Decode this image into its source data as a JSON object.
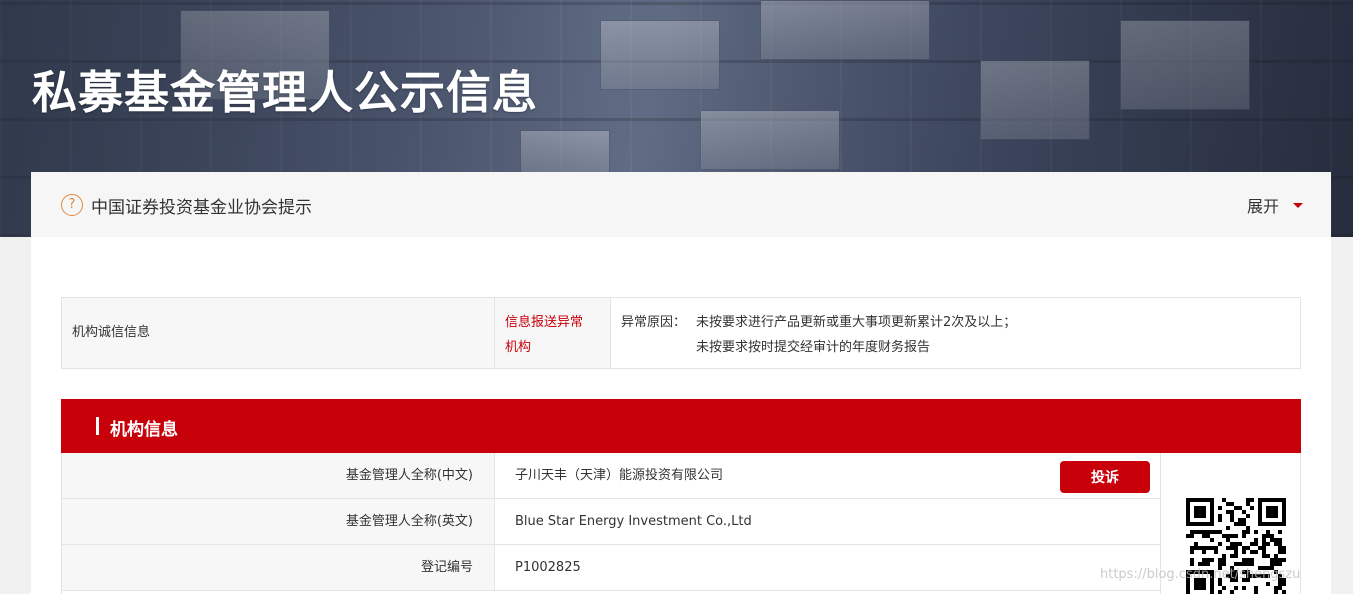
{
  "header": {
    "title": "私募基金管理人公示信息"
  },
  "notice": {
    "icon": "question-icon",
    "text": "中国证券投资基金业协会提示",
    "expand_label": "展开"
  },
  "integrity": {
    "label": "机构诚信信息",
    "status_line1": "信息报送异常",
    "status_line2": "机构",
    "reason_label": "异常原因：",
    "reasons": [
      "未按要求进行产品更新或重大事项更新累计2次及以上；",
      "未按要求按时提交经审计的年度财务报告"
    ]
  },
  "section": {
    "title": "机构信息"
  },
  "info_rows": [
    {
      "label": "基金管理人全称(中文)",
      "value": "子川天丰（天津）能源投资有限公司"
    },
    {
      "label": "基金管理人全称(英文)",
      "value": "Blue Star Energy Investment Co.,Ltd"
    },
    {
      "label": "登记编号",
      "value": "P1002825"
    }
  ],
  "actions": {
    "complain_label": "投诉"
  },
  "watermark": "https://blog.csdn.net/shengszu",
  "colors": {
    "accent": "#c8000a",
    "icon_orange": "#e0893e"
  }
}
